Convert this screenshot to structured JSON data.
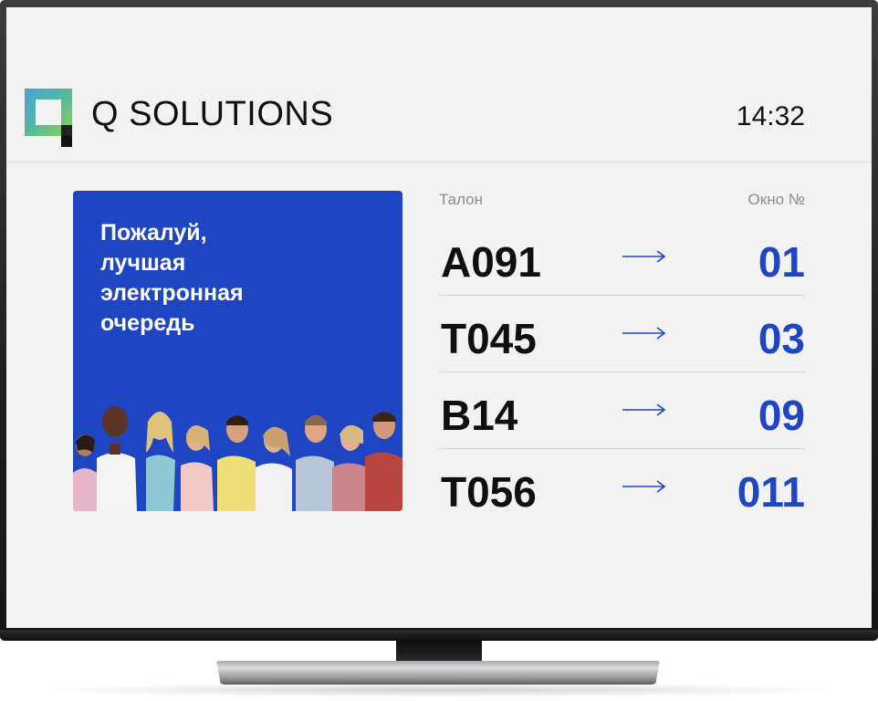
{
  "brand": {
    "name": "Q SOLUTIONS",
    "logo_icon": "q-solutions-logo-icon",
    "logo_colors": [
      "#4f9fd9",
      "#52b7a2",
      "#8fcf4f"
    ]
  },
  "header": {
    "time": "14:32"
  },
  "promo": {
    "lines": [
      "Пожалуй,",
      "лучшая",
      "электронная",
      "очередь"
    ],
    "background": "#1f46c2",
    "image": "people-in-queue-photo"
  },
  "queue": {
    "ticket_header": "Талон",
    "window_header": "Окно №",
    "arrow_icon": "right-arrow-icon",
    "accent": "#1f46c2",
    "rows": [
      {
        "ticket": "A091",
        "window": "01"
      },
      {
        "ticket": "T045",
        "window": "03"
      },
      {
        "ticket": "B14",
        "window": "09"
      },
      {
        "ticket": "T056",
        "window": "011"
      }
    ]
  }
}
